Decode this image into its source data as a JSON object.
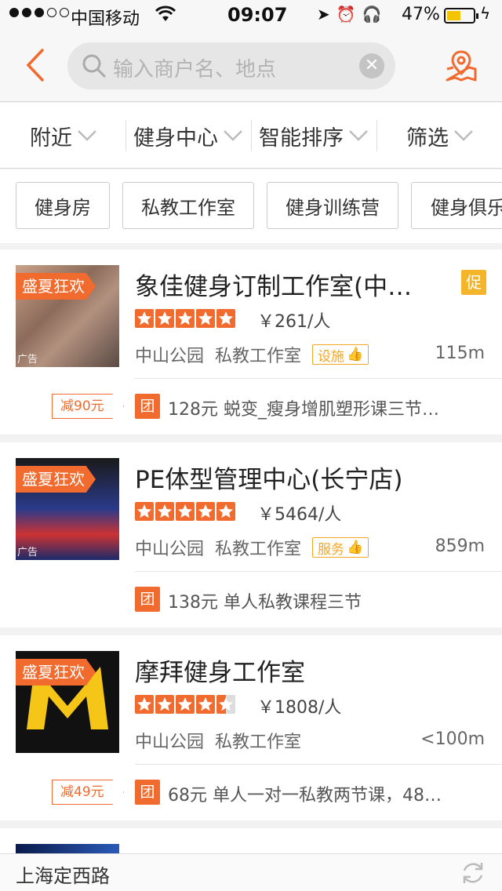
{
  "status_bar": {
    "carrier": "中国移动",
    "time": "09:07",
    "battery_pct": "47%",
    "battery_level": 0.47
  },
  "search": {
    "placeholder": "输入商户名、地点"
  },
  "filters": [
    {
      "label": "附近"
    },
    {
      "label": "健身中心"
    },
    {
      "label": "智能排序"
    },
    {
      "label": "筛选"
    }
  ],
  "tags": [
    "健身房",
    "私教工作室",
    "健身训练营",
    "健身俱乐"
  ],
  "listings": [
    {
      "ribbon": "盛夏狂欢",
      "ad_label": "广告",
      "name": "象佳健身订制工作室(中…",
      "promo_badge": "促",
      "rating": 5,
      "price": "￥261/人",
      "area": "中山公园",
      "category": "私教工作室",
      "facility_badge": "设施",
      "distance": "115m",
      "discount": "减90元",
      "deal_icon": "团",
      "deal": "128元 蜕变_瘦身增肌塑形课三节…"
    },
    {
      "ribbon": "盛夏狂欢",
      "ad_label": "广告",
      "name": "PE体型管理中心(长宁店)",
      "rating": 5,
      "price": "￥5464/人",
      "area": "中山公园",
      "category": "私教工作室",
      "facility_badge": "服务",
      "distance": "859m",
      "deal_icon": "团",
      "deal": "138元 单人私教课程三节"
    },
    {
      "ribbon": "盛夏狂欢",
      "name": "摩拜健身工作室",
      "rating": 4.5,
      "price": "￥1808/人",
      "area": "中山公园",
      "category": "私教工作室",
      "distance": "<100m",
      "discount": "减49元",
      "deal_icon": "团",
      "deal": "68元 单人一对一私教两节课，48…"
    }
  ],
  "bottom_bar": {
    "location": "上海定西路"
  },
  "colors": {
    "accent": "#f26b2e",
    "promo": "#f5b52a"
  }
}
